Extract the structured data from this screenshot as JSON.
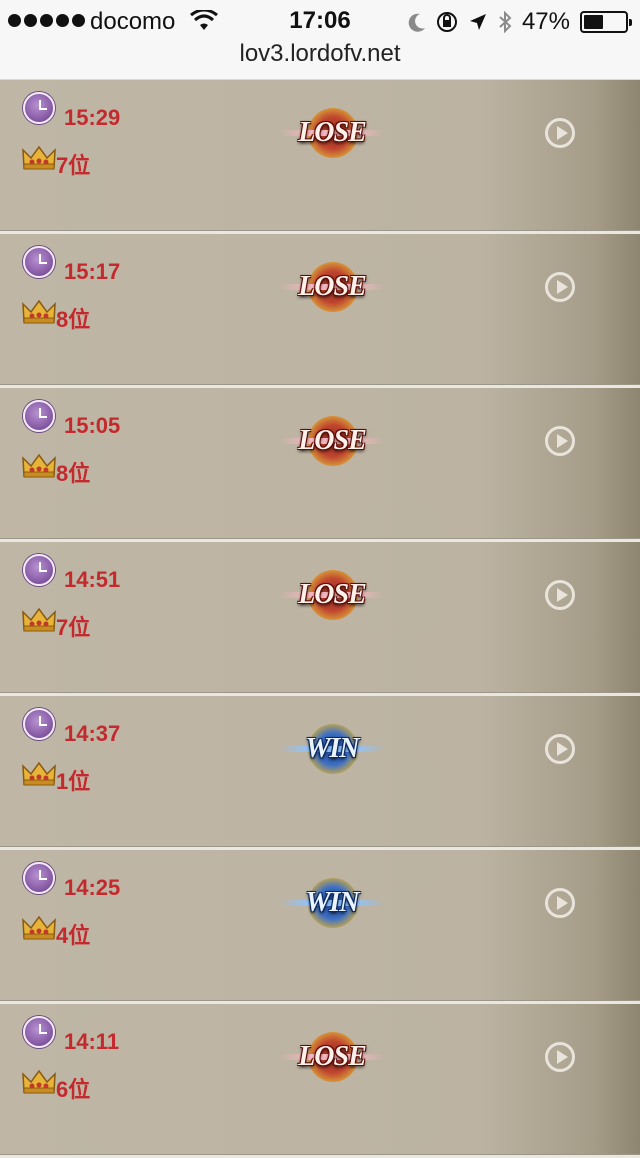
{
  "status_bar": {
    "carrier": "docomo",
    "time": "17:06",
    "battery_percent": "47%",
    "battery_level": 0.47
  },
  "browser": {
    "url": "lov3.lordofv.net"
  },
  "matches": [
    {
      "time": "15:29",
      "rank": "7位",
      "result": "LOSE"
    },
    {
      "time": "15:17",
      "rank": "8位",
      "result": "LOSE"
    },
    {
      "time": "15:05",
      "rank": "8位",
      "result": "LOSE"
    },
    {
      "time": "14:51",
      "rank": "7位",
      "result": "LOSE"
    },
    {
      "time": "14:37",
      "rank": "1位",
      "result": "WIN"
    },
    {
      "time": "14:25",
      "rank": "4位",
      "result": "WIN"
    },
    {
      "time": "14:11",
      "rank": "6位",
      "result": "LOSE"
    }
  ],
  "icons": {
    "clock": "clock-icon",
    "rank": "crown-icon",
    "replay": "play-icon"
  }
}
